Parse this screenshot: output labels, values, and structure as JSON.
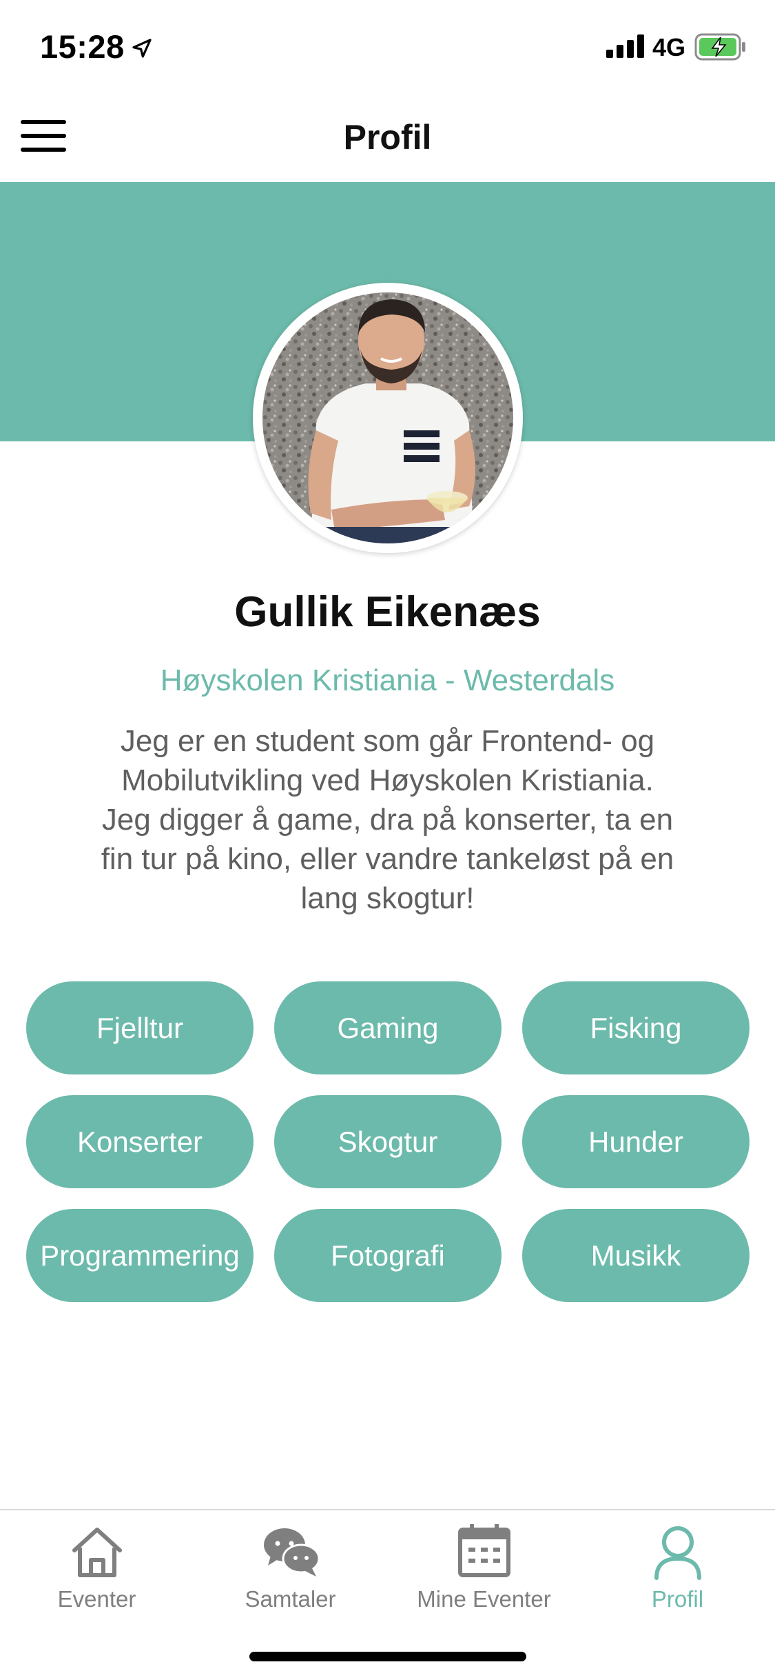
{
  "status_bar": {
    "time": "15:28",
    "network": "4G",
    "icons": [
      "location-arrow-icon",
      "signal-bars-icon",
      "battery-charging-icon"
    ]
  },
  "header": {
    "title": "Profil",
    "menu_icon": "hamburger-menu-icon"
  },
  "colors": {
    "accent": "#6cbaab",
    "text_dark": "#111111",
    "text_muted": "#5f5f5f",
    "tab_inactive": "#7f7f7f"
  },
  "profile": {
    "name": "Gullik Eikenæs",
    "school": "Høyskolen Kristiania - Westerdals",
    "bio_lines": [
      "Jeg er en student som går Frontend- og",
      "Mobilutvikling ved Høyskolen Kristiania.",
      "Jeg digger å game, dra på konserter, ta en",
      "fin tur på kino, eller vandre tankeløst på en",
      "lang skogtur!"
    ]
  },
  "interests": [
    "Fjelltur",
    "Gaming",
    "Fisking",
    "Konserter",
    "Skogtur",
    "Hunder",
    "Programmering",
    "Fotografi",
    "Musikk"
  ],
  "tabbar": {
    "tabs": [
      {
        "label": "Eventer",
        "icon": "home-icon",
        "active": false
      },
      {
        "label": "Samtaler",
        "icon": "chat-bubbles-icon",
        "active": false
      },
      {
        "label": "Mine Eventer",
        "icon": "calendar-icon",
        "active": false
      },
      {
        "label": "Profil",
        "icon": "user-icon",
        "active": true
      }
    ]
  }
}
